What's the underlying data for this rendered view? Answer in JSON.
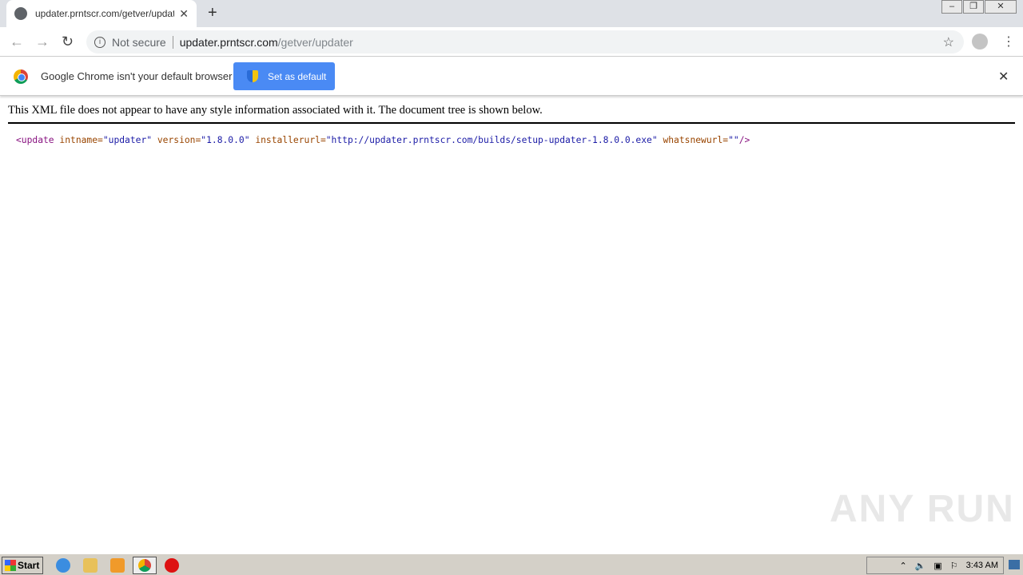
{
  "tab": {
    "title": "updater.prntscr.com/getver/updater",
    "icon": "globe-icon"
  },
  "omnibox": {
    "security": "Not secure",
    "host": "updater.prntscr.com",
    "path": "/getver/updater"
  },
  "infobar": {
    "text": "Google Chrome isn't your default browser",
    "button": "Set as default"
  },
  "page": {
    "message": "This XML file does not appear to have any style information associated with it. The document tree is shown below.",
    "xml": {
      "tag_open": "<update",
      "a1": "intname=",
      "v1": "\"updater\"",
      "a2": "version=",
      "v2": "\"1.8.0.0\"",
      "a3": "installerurl=",
      "v3": "\"http://updater.prntscr.com/builds/setup-updater-1.8.0.0.exe\"",
      "a4": "whatsnewurl=",
      "v4": "\"\"",
      "tag_close": "/>"
    }
  },
  "watermark": "ANY RUN",
  "taskbar": {
    "start": "Start",
    "clock": "3:43 AM"
  }
}
